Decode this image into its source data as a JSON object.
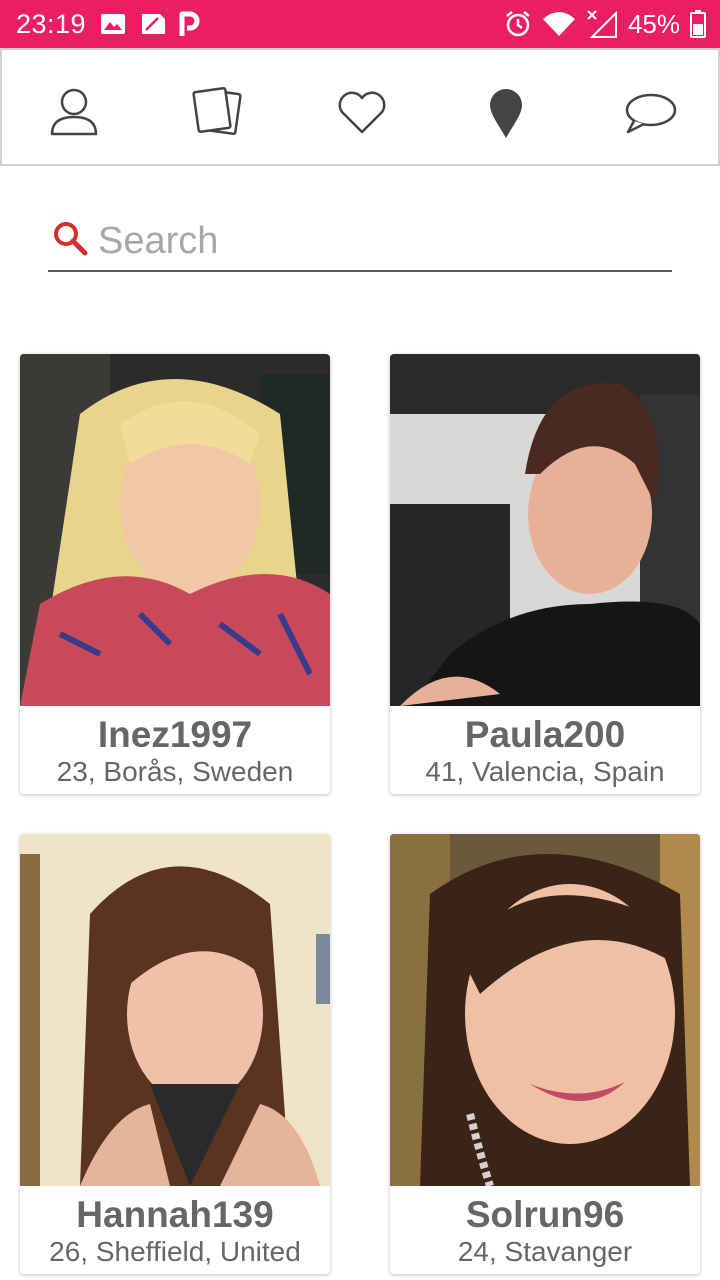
{
  "status_bar": {
    "time": "23:19",
    "battery_percent": "45%",
    "background_color": "#e91e63",
    "icons": [
      "image-icon",
      "sim-icon",
      "p-app-icon",
      "alarm-icon",
      "wifi-icon",
      "cellular-no-signal-icon",
      "battery-icon"
    ]
  },
  "nav": {
    "items": [
      {
        "icon": "profile-icon"
      },
      {
        "icon": "cards-icon"
      },
      {
        "icon": "heart-icon"
      },
      {
        "icon": "location-pin-icon"
      },
      {
        "icon": "chat-bubble-icon"
      }
    ]
  },
  "search": {
    "placeholder": "Search",
    "value": "",
    "icon": "search-icon",
    "icon_color": "#d32f2f"
  },
  "profiles": [
    {
      "name": "Inez1997",
      "info": "23, Borås, Sweden"
    },
    {
      "name": "Paula200",
      "info": "41, Valencia, Spain"
    },
    {
      "name": "Hannah139",
      "info": "26, Sheffield, United"
    },
    {
      "name": "Solrun96",
      "info": "24, Stavanger"
    }
  ]
}
